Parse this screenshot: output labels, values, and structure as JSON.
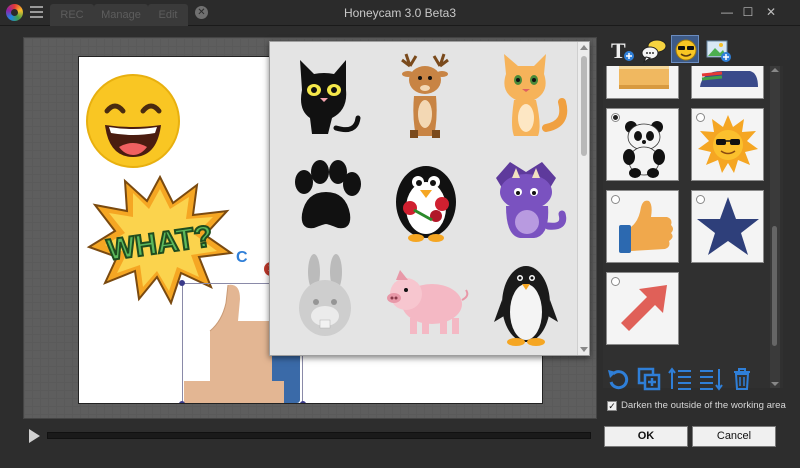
{
  "window": {
    "title": "Honeycam 3.0 Beta3",
    "minimize": "—",
    "maximize": "☐",
    "close": "✕"
  },
  "tabs": [
    {
      "label": "REC"
    },
    {
      "label": "Manage"
    },
    {
      "label": "Edit"
    }
  ],
  "canvas": {
    "sticker_text": "WHAT?",
    "delete_glyph": "x",
    "rotate_glyph": "C"
  },
  "sticker_picker": {
    "items": [
      "black-cat",
      "deer",
      "orange-cat",
      "paw-print",
      "penguin-with-roses",
      "purple-dinosaur",
      "rabbit",
      "pig",
      "penguin"
    ]
  },
  "right_panel": {
    "categories": [
      "text-icon",
      "speech-bubble-icon",
      "sticker-icon",
      "image-icon"
    ],
    "active_category": "sticker-icon",
    "list_items": [
      "cake",
      "rainbow-car",
      "panda",
      "sun-with-sunglasses",
      "thumbs-up",
      "star",
      "arrow"
    ],
    "checked_item": "panda",
    "tools": [
      "undo",
      "duplicate",
      "bring-forward",
      "send-backward",
      "delete"
    ],
    "darken_checked": true,
    "darken_label": "Darken the outside of the working area",
    "ok_label": "OK",
    "cancel_label": "Cancel"
  },
  "colors": {
    "accent": "#2f7fd8",
    "star": "#2e3f7a",
    "arrow": "#e06058",
    "thumb_skin": "#e8a85c",
    "thumb_cuff": "#2c69b0"
  }
}
